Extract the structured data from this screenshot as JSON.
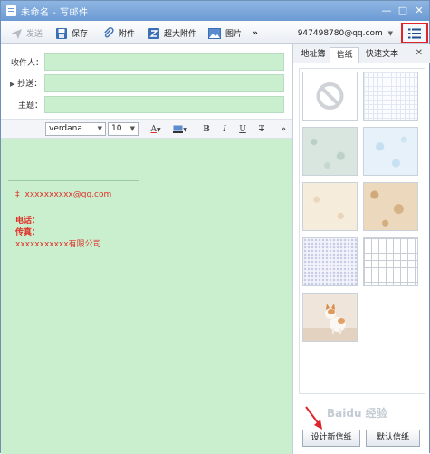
{
  "window": {
    "title": "未命名 - 写邮件"
  },
  "toolbar": {
    "send_label": "发送",
    "save_label": "保存",
    "attach_label": "附件",
    "bigattach_label": "超大附件",
    "picture_label": "图片",
    "more_label": "»",
    "account": "947498780@qq.com"
  },
  "fields": {
    "to_label": "收件人：",
    "cc_label": "抄送：",
    "subject_label": "主题："
  },
  "format": {
    "font": "verdana",
    "size": "10",
    "more_label": "»"
  },
  "signature": {
    "email": "xxxxxxxxxx@qq.com",
    "phone": "电话：",
    "fax": "传真：",
    "company": "xxxxxxxxxxx有限公司"
  },
  "side": {
    "tabs": [
      "地址簿",
      "信纸",
      "快速文本"
    ],
    "design_label": "设计新信纸",
    "default_label": "默认信纸",
    "watermark": "Baidu 经验"
  },
  "colors": {
    "accent": "#e0242c",
    "editor_bg": "#c9efcf",
    "titlebar": "#7ba5d9"
  }
}
